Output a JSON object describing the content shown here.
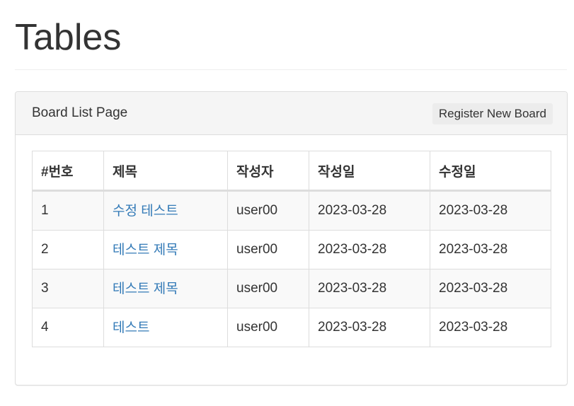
{
  "page": {
    "title": "Tables"
  },
  "panel": {
    "heading": "Board List Page",
    "register_label": "Register New Board"
  },
  "table": {
    "headers": [
      "#번호",
      "제목",
      "작성자",
      "작성일",
      "수정일"
    ],
    "rows": [
      {
        "no": "1",
        "title": "수정 테스트",
        "writer": "user00",
        "regdate": "2023-03-28",
        "updatedate": "2023-03-28"
      },
      {
        "no": "2",
        "title": "테스트 제목",
        "writer": "user00",
        "regdate": "2023-03-28",
        "updatedate": "2023-03-28"
      },
      {
        "no": "3",
        "title": "테스트 제목",
        "writer": "user00",
        "regdate": "2023-03-28",
        "updatedate": "2023-03-28"
      },
      {
        "no": "4",
        "title": "테스트",
        "writer": "user00",
        "regdate": "2023-03-28",
        "updatedate": "2023-03-28"
      }
    ]
  },
  "colors": {
    "link": "#337ab7",
    "heading_bg": "#f5f5f5",
    "border": "#dddddd"
  }
}
